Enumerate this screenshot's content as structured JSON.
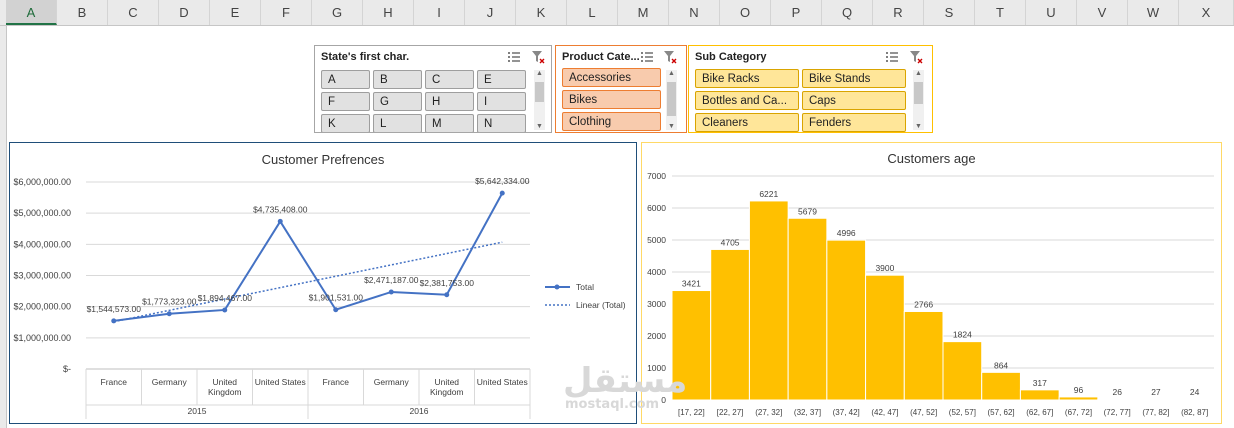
{
  "columns": [
    "A",
    "B",
    "C",
    "D",
    "E",
    "F",
    "G",
    "H",
    "I",
    "J",
    "K",
    "L",
    "M",
    "N",
    "O",
    "P",
    "Q",
    "R",
    "S",
    "T",
    "U",
    "V",
    "W",
    "X"
  ],
  "selected_column": "A",
  "slicers": {
    "state": {
      "title": "State's first char.",
      "items": [
        "A",
        "B",
        "C",
        "E",
        "F",
        "G",
        "H",
        "I",
        "K",
        "L",
        "M",
        "N"
      ]
    },
    "category": {
      "title": "Product Cate...",
      "items": [
        "Accessories",
        "Bikes",
        "Clothing"
      ]
    },
    "subcategory": {
      "title": "Sub Category",
      "items": [
        "Bike Racks",
        "Bike Stands",
        "Bottles and Ca...",
        "Caps",
        "Cleaners",
        "Fenders"
      ]
    }
  },
  "colors": {
    "line": "#4472c4",
    "bar": "#ffc000",
    "category_btn": "#f8cbad",
    "subcategory_btn": "#ffe699",
    "state_btn": "#e1e1e1"
  },
  "charts": {
    "preferences": {
      "title": "Customer Prefrences",
      "legend": {
        "series": "Total",
        "trend": "Linear (Total)"
      },
      "y_ticks": [
        "$6,000,000.00",
        "$5,000,000.00",
        "$4,000,000.00",
        "$3,000,000.00",
        "$2,000,000.00",
        "$1,000,000.00",
        "$-"
      ]
    },
    "ages": {
      "title": "Customers age",
      "y_ticks": [
        "7000",
        "6000",
        "5000",
        "4000",
        "3000",
        "2000",
        "1000",
        "0"
      ]
    }
  },
  "chart_data": [
    {
      "type": "line",
      "title": "Customer Prefrences",
      "groups": [
        "2015",
        "2016"
      ],
      "categories": [
        "France",
        "Germany",
        "United Kingdom",
        "United States",
        "France",
        "Germany",
        "United Kingdom",
        "United States"
      ],
      "series": [
        {
          "name": "Total",
          "values": [
            1544573,
            1773323,
            1894467,
            4735408,
            1901531,
            2471187,
            2381753,
            5642334
          ],
          "labels": [
            "$1,544,573.00",
            "$1,773,323.00",
            "$1,894,467.00",
            "$4,735,408.00",
            "$1,901,531.00",
            "$2,471,187.00",
            "$2,381,753.00",
            "$5,642,334.00"
          ]
        }
      ],
      "trendline": {
        "name": "Linear (Total)",
        "type": "linear"
      },
      "ylim": [
        0,
        6000000
      ],
      "legend_position": "right",
      "grid": true
    },
    {
      "type": "bar",
      "title": "Customers age",
      "categories": [
        "[17, 22]",
        "[22, 27]",
        "(27, 32]",
        "(32, 37]",
        "(37, 42]",
        "(42, 47]",
        "(47, 52]",
        "(52, 57]",
        "(57, 62]",
        "(62, 67]",
        "(67, 72]",
        "(72, 77]",
        "(77, 82]",
        "(82, 87]"
      ],
      "values": [
        3421,
        4705,
        6221,
        5679,
        4996,
        3900,
        2766,
        1824,
        864,
        317,
        96,
        26,
        27,
        24
      ],
      "ylim": [
        0,
        7000
      ],
      "grid": true
    }
  ],
  "watermark": "مستقل",
  "watermark_sub": "mostaql.com"
}
